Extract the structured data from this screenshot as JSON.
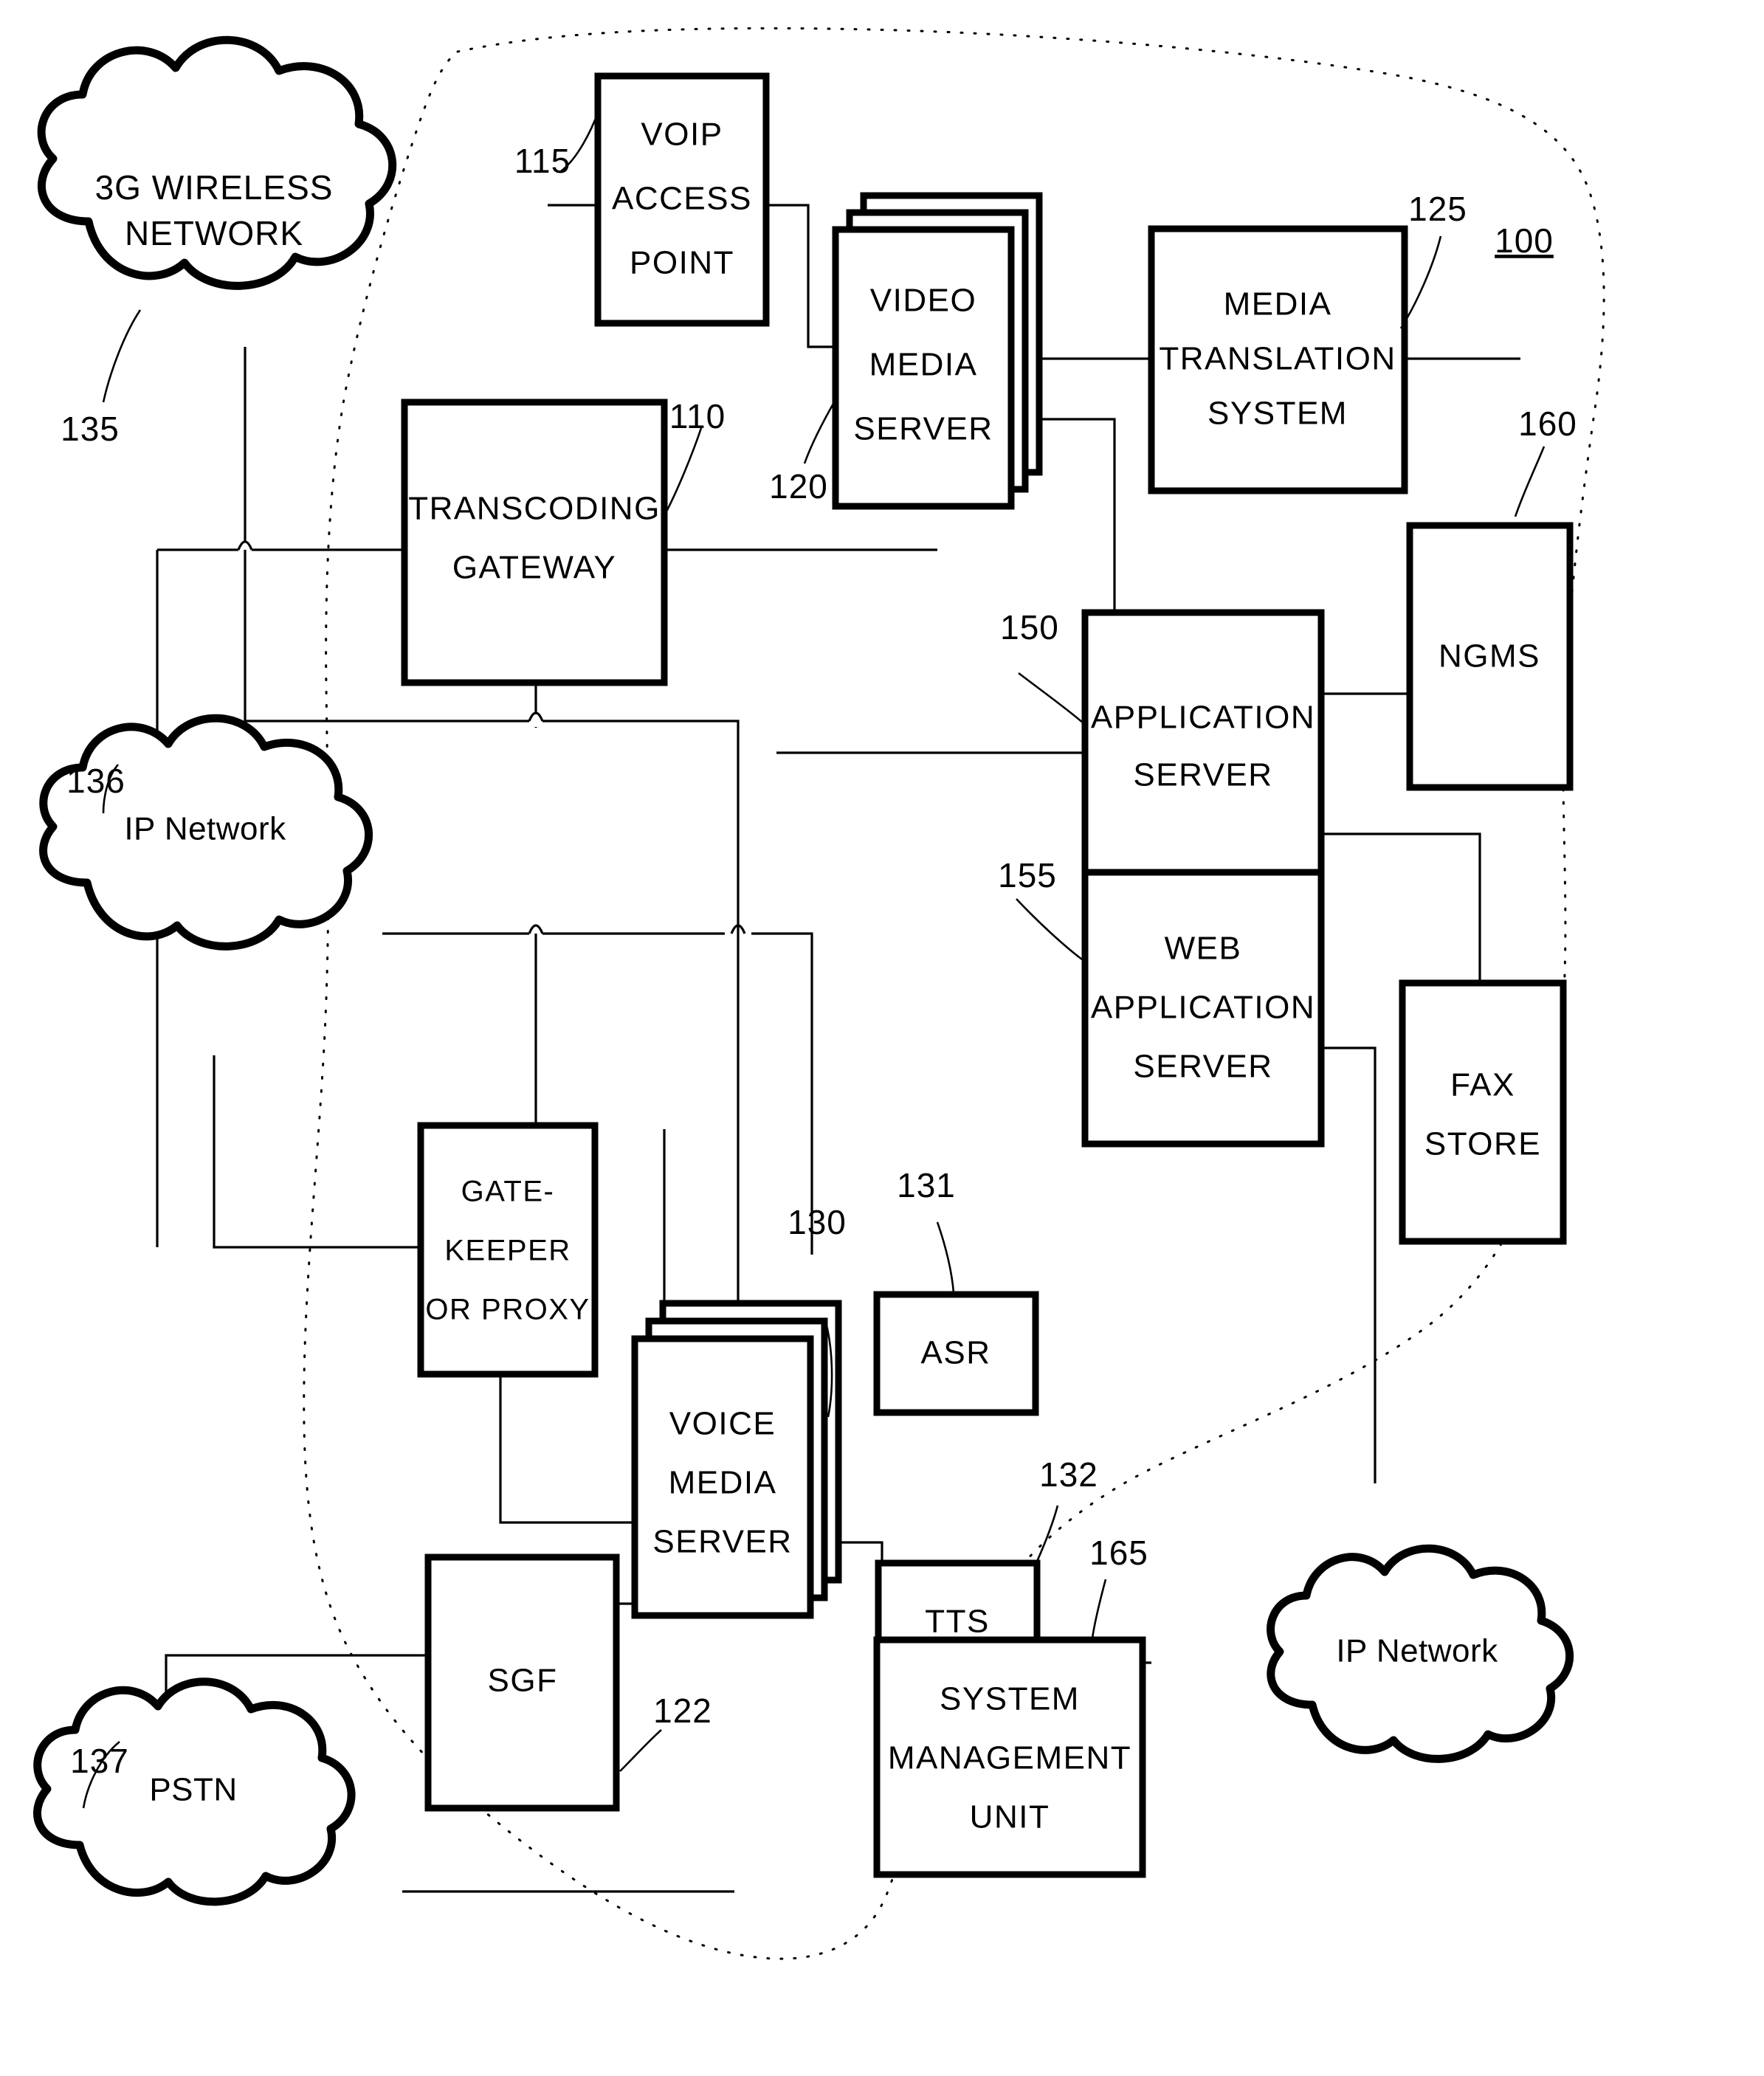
{
  "figure": {
    "system_reference": "100",
    "clouds": [
      {
        "id": "wireless-3g",
        "label_line1": "3G WIRELESS",
        "label_line2": "NETWORK",
        "ref": "135"
      },
      {
        "id": "ip-network-left",
        "label_line1": "IP Network",
        "label_line2": "",
        "ref": "136"
      },
      {
        "id": "pstn",
        "label_line1": "PSTN",
        "label_line2": "",
        "ref": "137"
      },
      {
        "id": "ip-network-right",
        "label_line1": "IP Network",
        "label_line2": "",
        "ref": ""
      }
    ],
    "boxes": [
      {
        "id": "voip-access-point",
        "lines": [
          "VOIP",
          "ACCESS",
          "POINT"
        ],
        "ref": "115"
      },
      {
        "id": "video-media-server",
        "lines": [
          "VIDEO",
          "MEDIA",
          "SERVER"
        ],
        "ref": "120",
        "stacked": true
      },
      {
        "id": "media-translation-system",
        "lines": [
          "MEDIA",
          "TRANSLATION",
          "SYSTEM"
        ],
        "ref": "125"
      },
      {
        "id": "transcoding-gateway",
        "lines": [
          "TRANSCODING",
          "GATEWAY"
        ],
        "ref": "110"
      },
      {
        "id": "application-server",
        "lines": [
          "APPLICATION",
          "SERVER"
        ],
        "ref": "150"
      },
      {
        "id": "web-application-server",
        "lines": [
          "WEB",
          "APPLICATION",
          "SERVER"
        ],
        "ref": "155"
      },
      {
        "id": "ngms",
        "lines": [
          "NGMS"
        ],
        "ref": "160"
      },
      {
        "id": "fax-store",
        "lines": [
          "FAX",
          "STORE"
        ],
        "ref": ""
      },
      {
        "id": "gatekeeper-or-proxy",
        "lines": [
          "GATE-",
          "KEEPER",
          "OR PROXY"
        ],
        "ref": ""
      },
      {
        "id": "voice-media-server",
        "lines": [
          "VOICE",
          "MEDIA",
          "SERVER"
        ],
        "ref": "130",
        "stacked": true
      },
      {
        "id": "asr",
        "lines": [
          "ASR"
        ],
        "ref": "131"
      },
      {
        "id": "tts",
        "lines": [
          "TTS"
        ],
        "ref": "132"
      },
      {
        "id": "system-management-unit",
        "lines": [
          "SYSTEM",
          "MANAGEMENT",
          "UNIT"
        ],
        "ref": "165"
      },
      {
        "id": "sgf",
        "lines": [
          "SGF"
        ],
        "ref": "122"
      }
    ],
    "reference_numerals": [
      "100",
      "110",
      "115",
      "120",
      "122",
      "125",
      "130",
      "131",
      "132",
      "135",
      "136",
      "137",
      "150",
      "155",
      "160",
      "165"
    ]
  }
}
